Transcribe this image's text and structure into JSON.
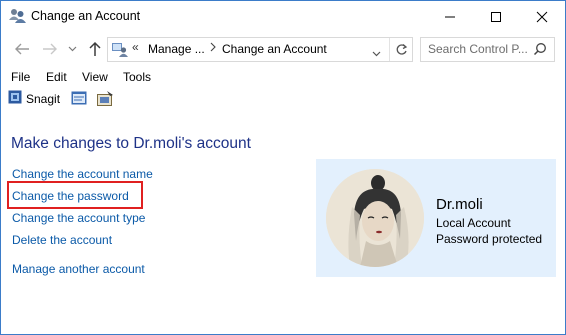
{
  "window": {
    "title": "Change an Account"
  },
  "address_bar": {
    "overflow_marker": "«",
    "crumbs": [
      "Manage ...",
      "Change an Account"
    ]
  },
  "search": {
    "placeholder": "Search Control P..."
  },
  "menu": [
    "File",
    "Edit",
    "View",
    "Tools"
  ],
  "toolbar": {
    "snagit_label": "Snagit"
  },
  "main": {
    "heading": "Make changes to Dr.moli's account",
    "tasks": [
      "Change the account name",
      "Change the password",
      "Change the account type",
      "Delete the account",
      "Manage another account"
    ]
  },
  "account": {
    "name": "Dr.moli",
    "type": "Local Account",
    "password_status": "Password protected"
  },
  "colors": {
    "heading": "#1e3287",
    "link": "#0b5aa8",
    "card_bg": "#e3f0fd",
    "highlight": "#e02020",
    "window_border": "#3b7cc9"
  }
}
